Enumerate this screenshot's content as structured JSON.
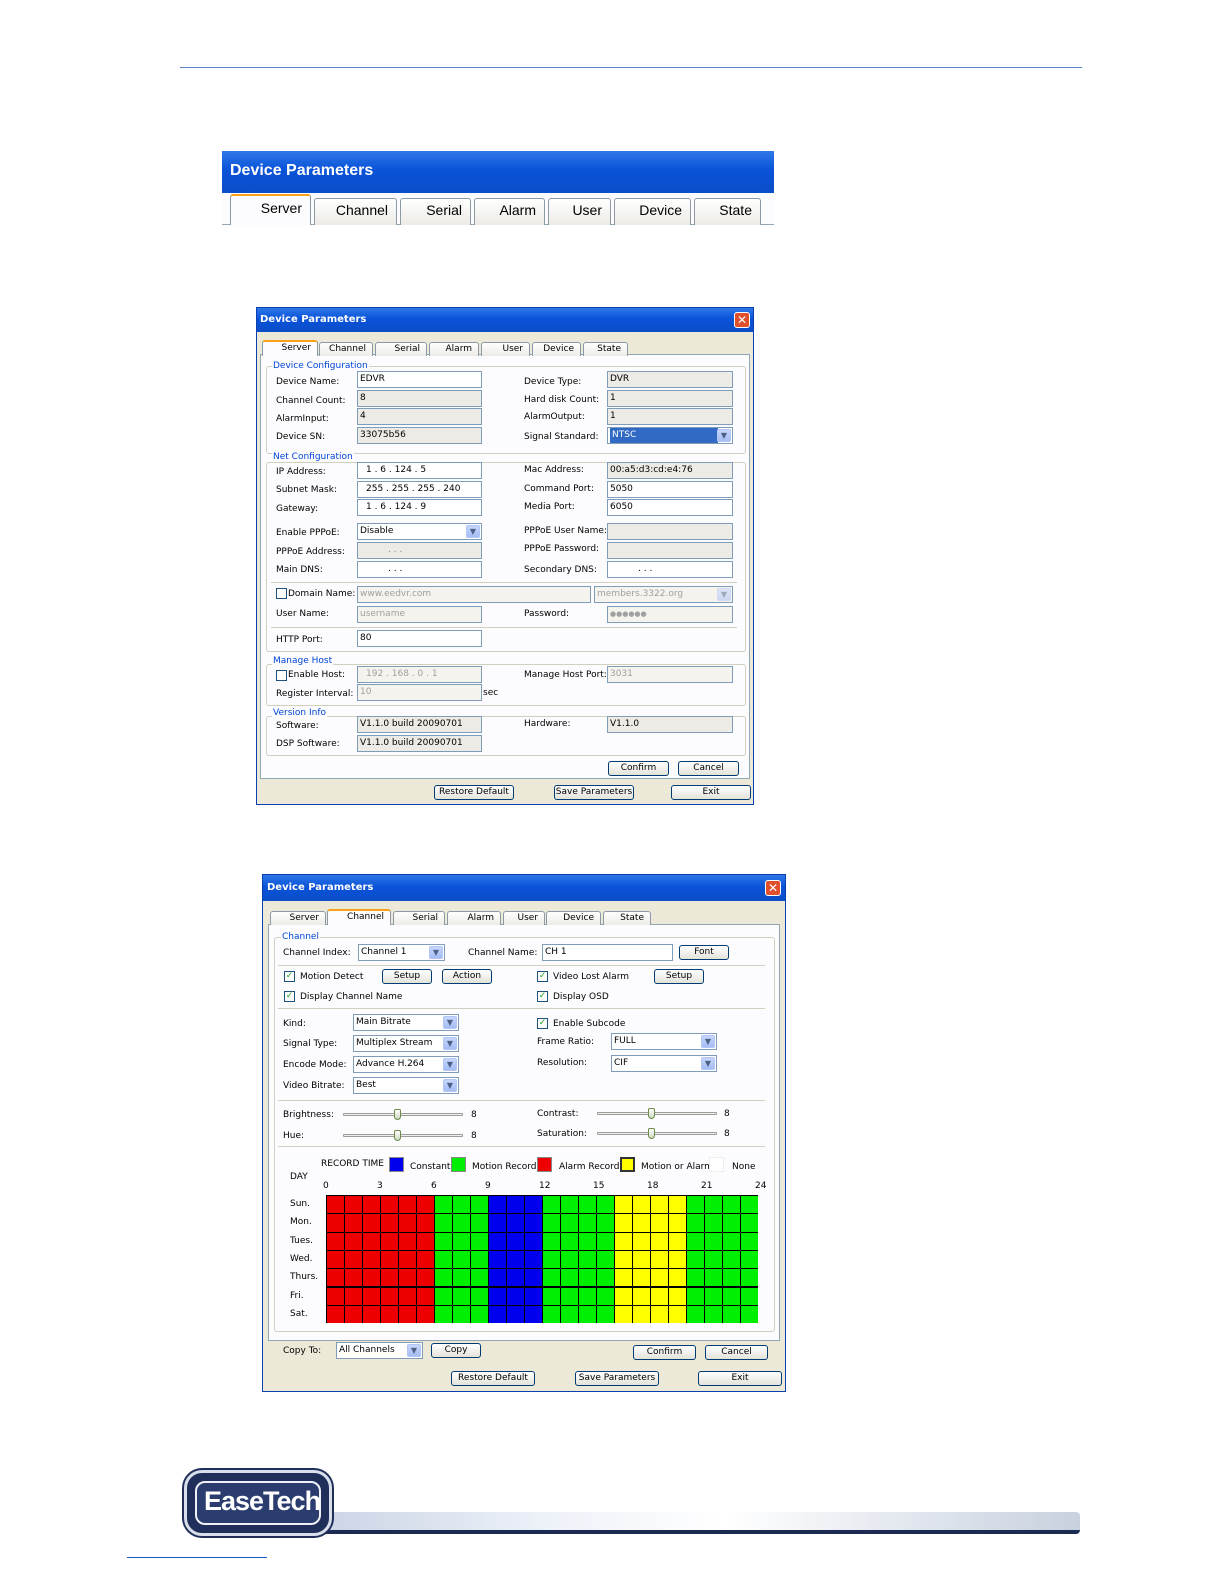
{
  "colors": {
    "constant": "#0000ee",
    "motion": "#00ee00",
    "alarm": "#ee0000",
    "motion_or_alarm": "#ffff00",
    "none": "#ffffff",
    "title_blue": "#0a52d8",
    "group_label": "#0046d5"
  },
  "strip": {
    "title": "Device Parameters",
    "tabs": [
      "Server",
      "Channel",
      "Serial",
      "Alarm",
      "User",
      "Device",
      "State"
    ]
  },
  "dlg1": {
    "title": "Device Parameters",
    "tabs": [
      "Server",
      "Channel",
      "Serial",
      "Alarm",
      "User",
      "Device",
      "State"
    ],
    "device_config": {
      "label": "Device Configuration",
      "device_name_label": "Device Name:",
      "device_name": "EDVR",
      "device_type_label": "Device Type:",
      "device_type": "DVR",
      "channel_count_label": "Channel Count:",
      "channel_count": "8",
      "hdd_count_label": "Hard disk Count:",
      "hdd_count": "1",
      "alarm_input_label": "AlarmInput:",
      "alarm_input": "4",
      "alarm_output_label": "AlarmOutput:",
      "alarm_output": "1",
      "device_sn_label": "Device SN:",
      "device_sn": "33075b56",
      "signal_label": "Signal Standard:",
      "signal": "NTSC"
    },
    "net_config": {
      "label": "Net Configuration",
      "ip_label": "IP Address:",
      "ip": "1   .   6   .  124  .   5",
      "mac_label": "Mac Address:",
      "mac": "00:a5:d3:cd:e4:76",
      "mask_label": "Subnet Mask:",
      "mask": "255  . 255  . 255  . 240",
      "cmd_port_label": "Command Port:",
      "cmd_port": "5050",
      "gateway_label": "Gateway:",
      "gateway": "1   .   6   .  124  .   9",
      "media_port_label": "Media Port:",
      "media_port": "6050",
      "pppoe_label": "Enable PPPoE:",
      "pppoe": "Disable",
      "pppoe_user_label": "PPPoE User Name:",
      "pppoe_addr_label": "PPPoE Address:",
      "pppoe_addr": ".       .       .",
      "pppoe_pass_label": "PPPoE Password:",
      "main_dns_label": "Main DNS:",
      "main_dns": ".       .       .",
      "sec_dns_label": "Secondary DNS:",
      "sec_dns": ".       .       .",
      "domain_label": "Domain Name:",
      "domain": "www.eedvr.com",
      "domain_server": "members.3322.org",
      "user_label": "User Name:",
      "user": "username",
      "pass_label": "Password:",
      "pass": "●●●●●●",
      "http_label": "HTTP Port:",
      "http": "80"
    },
    "manage_host": {
      "label": "Manage Host",
      "enable_label": "Enable Host:",
      "host": "192  .  168  .   0   .   1",
      "port_label": "Manage Host Port:",
      "port": "3031",
      "interval_label": "Register Interval:",
      "interval": "10",
      "sec": "sec"
    },
    "version": {
      "label": "Version Info",
      "software_label": "Software:",
      "software": "V1.1.0 build 20090701",
      "hardware_label": "Hardware:",
      "hardware": "V1.1.0",
      "dsp_label": "DSP Software:",
      "dsp": "V1.1.0 build 20090701"
    },
    "confirm": "Confirm",
    "cancel": "Cancel",
    "restore": "Restore Default",
    "save": "Save Parameters",
    "exit": "Exit"
  },
  "dlg2": {
    "title": "Device Parameters",
    "tabs": [
      "Server",
      "Channel",
      "Serial",
      "Alarm",
      "User",
      "Device",
      "State"
    ],
    "group_label": "Channel",
    "channel_index_label": "Channel Index:",
    "channel_index": "Channel 1",
    "channel_name_label": "Channel Name:",
    "channel_name": "CH 1",
    "font": "Font",
    "motion_detect": "Motion Detect",
    "setup": "Setup",
    "action": "Action",
    "video_lost": "Video Lost Alarm",
    "display_channel_name": "Display Channel Name",
    "display_osd": "Display OSD",
    "kind_label": "Kind:",
    "kind": "Main Bitrate",
    "enable_subcode": "Enable Subcode",
    "signal_type_label": "Signal Type:",
    "signal_type": "Multiplex Stream",
    "frame_ratio_label": "Frame Ratio:",
    "frame_ratio": "FULL",
    "encode_mode_label": "Encode Mode:",
    "encode_mode": "Advance H.264",
    "resolution_label": "Resolution:",
    "resolution": "CIF",
    "video_bitrate_label": "Video Bitrate:",
    "video_bitrate": "Best",
    "brightness_label": "Brightness:",
    "brightness": "8",
    "contrast_label": "Contrast:",
    "contrast": "8",
    "hue_label": "Hue:",
    "hue": "8",
    "saturation_label": "Saturation:",
    "saturation": "8",
    "slider_fraction": 0.45,
    "record_time": "RECORD TIME",
    "day": "DAY",
    "legend": [
      "Constant",
      "Motion Record",
      "Alarm Record",
      "Motion or Alarm",
      "None"
    ],
    "hours": [
      "0",
      "3",
      "6",
      "9",
      "12",
      "15",
      "18",
      "21",
      "24"
    ],
    "days": [
      "Sun.",
      "Mon.",
      "Tues.",
      "Wed.",
      "Thurs.",
      "Fri.",
      "Sat."
    ],
    "schedule": {
      "alarm": [
        0,
        6
      ],
      "motion": [
        6,
        9
      ],
      "constant": [
        9,
        12
      ],
      "motion_2": [
        12,
        16
      ],
      "motion_or_alarm": [
        16,
        20
      ],
      "motion_3": [
        20,
        24
      ]
    },
    "copy_to_label": "Copy To:",
    "copy_to": "All Channels",
    "copy": "Copy",
    "confirm": "Confirm",
    "cancel": "Cancel",
    "restore": "Restore Default",
    "save": "Save Parameters",
    "exit": "Exit"
  },
  "footer": {
    "logo_text": "EaseTech"
  }
}
